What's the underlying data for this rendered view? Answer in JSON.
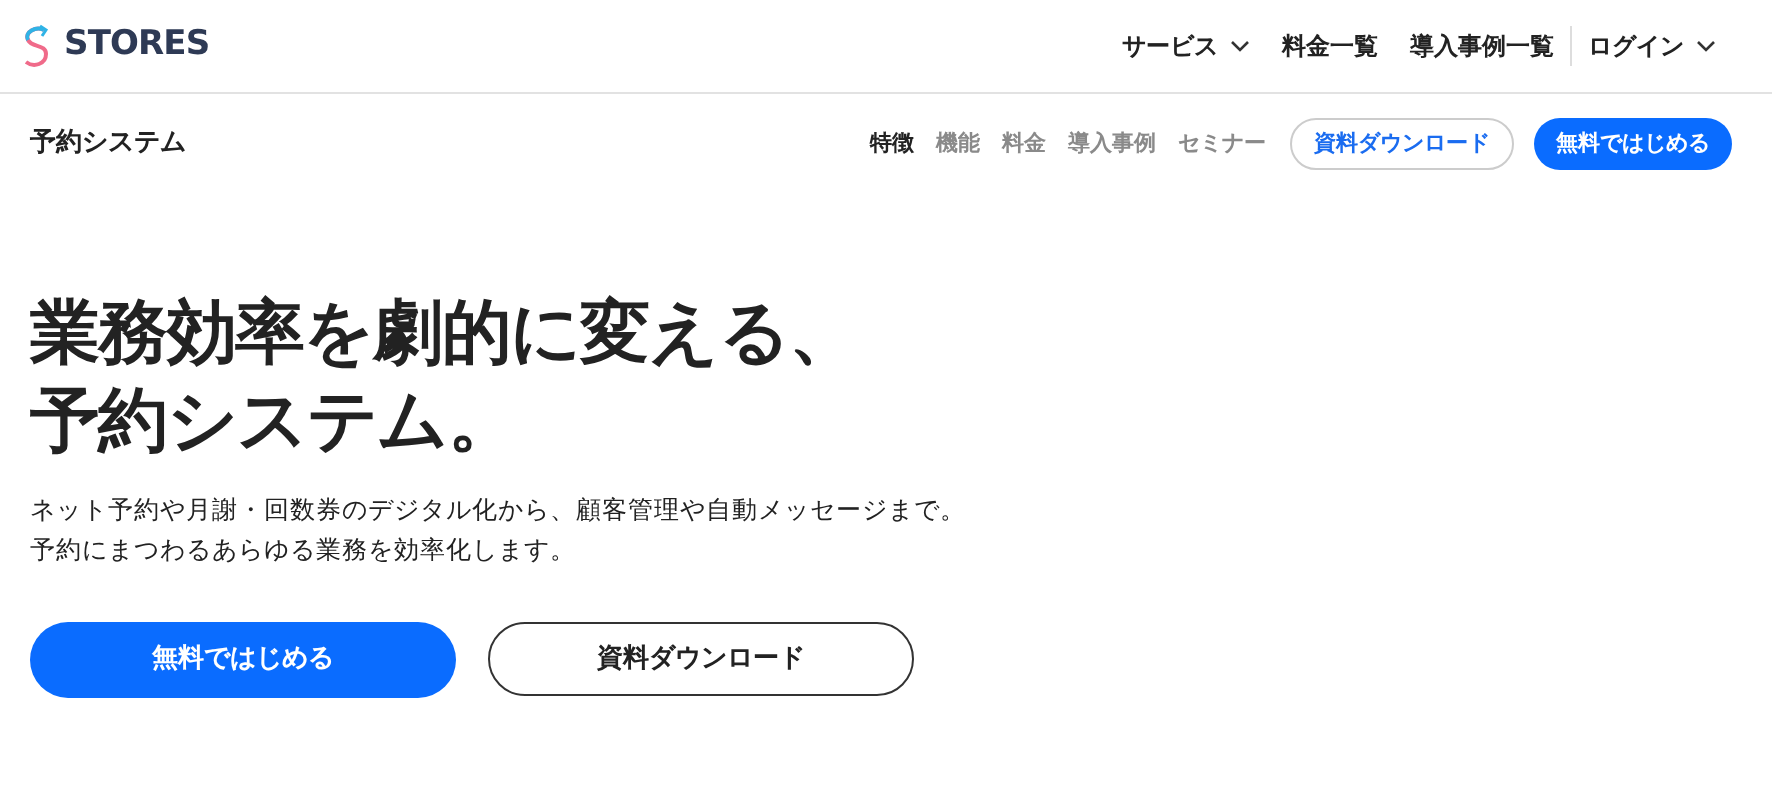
{
  "header": {
    "logo": "STORES",
    "nav": [
      {
        "label": "サービス",
        "kind": "dropdown"
      },
      {
        "label": "料金一覧",
        "kind": "link"
      },
      {
        "label": "導入事例一覧",
        "kind": "link"
      },
      {
        "label": "ログイン",
        "kind": "dropdown"
      }
    ]
  },
  "subnav": {
    "title": "予約システム",
    "items": [
      {
        "label": "特徴",
        "selected": true
      },
      {
        "label": "機能",
        "selected": false
      },
      {
        "label": "料金",
        "selected": false
      },
      {
        "label": "導入事例",
        "selected": false
      },
      {
        "label": "セミナー",
        "selected": false
      }
    ],
    "download_button": "資料ダウンロード",
    "start_button": "無料ではじめる"
  },
  "hero": {
    "headline": [
      "業務効率を劇的に変える、",
      "予約システム。"
    ],
    "description": [
      "ネット予約や月謝・回数券のデジタル化から、顧客管理や自動メッセージまで。",
      "予約にまつわるあらゆる業務を効率化します。"
    ],
    "start_button": "無料ではじめる",
    "download_button": "資料ダウンロード"
  }
}
